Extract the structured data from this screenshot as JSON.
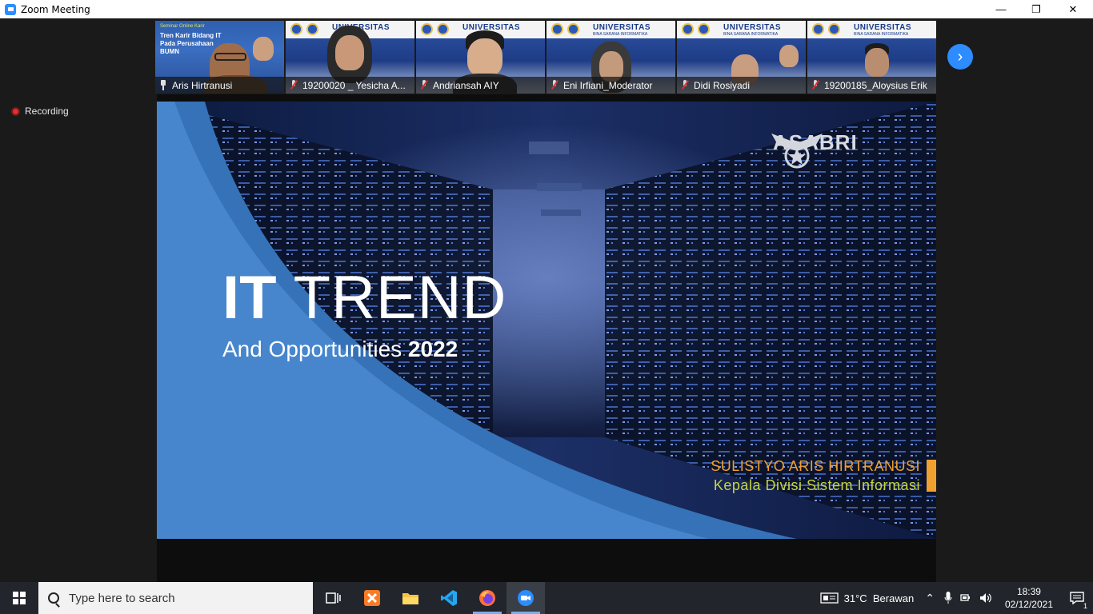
{
  "window": {
    "title": "Zoom Meeting",
    "minimize_glyph": "—",
    "restore_glyph": "❐",
    "close_glyph": "✕"
  },
  "participants": [
    {
      "name": "Aris Hirtranusi",
      "status_icon": "pin-icon",
      "active": true
    },
    {
      "name": "19200020 _ Yesicha A...",
      "status_icon": "mic-muted-icon",
      "active": false
    },
    {
      "name": "Andriansah AIY",
      "status_icon": "mic-muted-icon",
      "active": false
    },
    {
      "name": "Eni Irfiani_Moderator",
      "status_icon": "mic-muted-icon",
      "active": false
    },
    {
      "name": "Didi Rosiyadi",
      "status_icon": "mic-muted-icon",
      "active": false
    },
    {
      "name": "19200185_Aloysius Erik",
      "status_icon": "mic-muted-icon",
      "active": false
    }
  ],
  "poster": {
    "university": "UNIVERSITAS",
    "university_sub": "BINA SARANA INFORMATIKA",
    "seminar": "Seminar Online Karir",
    "topic_line1": "Tren Karir Bidang IT",
    "topic_line2": "Pada Perusahaan BUMN"
  },
  "recording_label": "Recording",
  "slide": {
    "brand": "ASABRI",
    "headline_bold": "IT",
    "headline_rest": "TREND",
    "sub_text": "And Opportunities",
    "sub_year": "2022",
    "speaker_name": "SULISTYO ARIS HIRTRANUSI",
    "speaker_role": "Kepala Divisi Sistem Informasi"
  },
  "taskbar": {
    "search_placeholder": "Type here to search",
    "weather": "31°C  Berawan",
    "time": "18:39",
    "date": "02/12/2021",
    "notification_count": "1"
  },
  "colors": {
    "zoom_blue": "#2d8cff",
    "active_speaker": "#c7d41a",
    "speaker_name": "#f0a030",
    "speaker_role": "#c7d441",
    "recording_red": "#e2302a"
  }
}
